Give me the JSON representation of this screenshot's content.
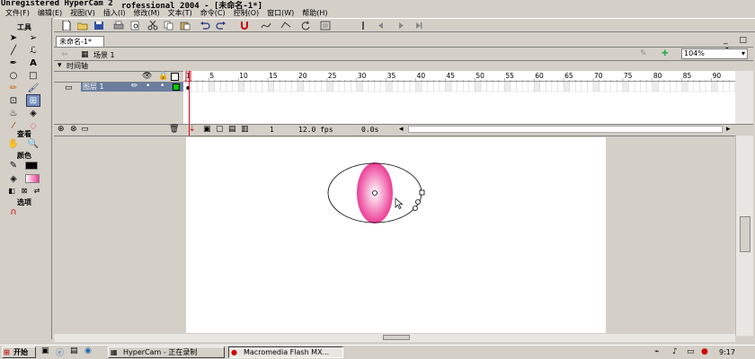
{
  "window": {
    "title_watermark": "Unregistered HyperCam 2",
    "title_rest": "rofessional 2004 - [未命名-1*]"
  },
  "menu": [
    "文件(F)",
    "编辑(E)",
    "视图(V)",
    "插入(I)",
    "修改(M)",
    "文本(T)",
    "命令(C)",
    "控制(O)",
    "窗口(W)",
    "帮助(H)"
  ],
  "tools": {
    "title": "工具",
    "view_title": "查看",
    "colors_title": "颜色",
    "options_title": "选项"
  },
  "document": {
    "tab_label": "未命名-1*",
    "scene_label": "场景 1",
    "zoom": "104%"
  },
  "timeline": {
    "title": "时间轴",
    "layer_name": "图层 1",
    "frame_ticks": [
      "1",
      "5",
      "10",
      "15",
      "20",
      "25",
      "30",
      "35",
      "40",
      "45",
      "50",
      "55",
      "60",
      "65",
      "70",
      "75",
      "80",
      "85",
      "90"
    ],
    "current_frame": "1",
    "fps": "12.0 fps",
    "elapsed": "0.0s"
  },
  "taskbar": {
    "start": "开始",
    "tasks": [
      "HyperCam - 正在录制",
      "Macromedia Flash MX..."
    ],
    "clock": "9:17"
  },
  "colors": {
    "fill_pink": "#ec3b95",
    "selection_blue": "#6a7d9e",
    "playhead_red": "#e0001a"
  }
}
